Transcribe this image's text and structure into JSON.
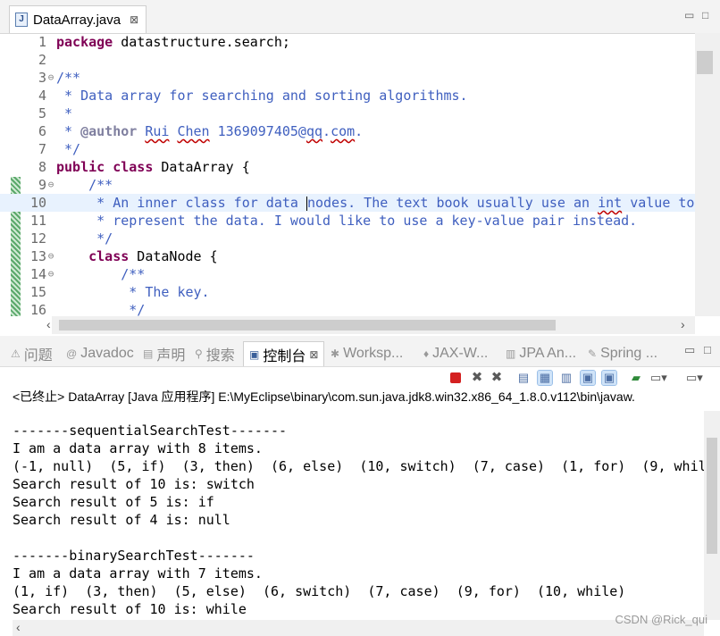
{
  "editor": {
    "tab": {
      "title": "DataArray.java",
      "close": "⊠"
    },
    "window_controls": {
      "minimize": "▭",
      "maximize": "□"
    },
    "lines": [
      {
        "n": "1",
        "fold": "",
        "html": "<span class=\"kw\">package</span> datastructure.search;"
      },
      {
        "n": "2",
        "fold": "",
        "html": ""
      },
      {
        "n": "3",
        "fold": "⊖",
        "html": "<span class=\"cm\">/**</span>"
      },
      {
        "n": "4",
        "fold": "",
        "html": "<span class=\"cm\"> * Data array for searching and sorting algorithms.</span>"
      },
      {
        "n": "5",
        "fold": "",
        "html": "<span class=\"cm\"> *</span>"
      },
      {
        "n": "6",
        "fold": "",
        "html": "<span class=\"cm\"> * <span class=\"tag\">@author</span> <span class=\"sq\">Rui</span> <span class=\"sq\">Chen</span> 1369097405@<span class=\"sq\">qq</span>.<span class=\"sq\">com</span>.</span>"
      },
      {
        "n": "7",
        "fold": "",
        "html": "<span class=\"cm\"> */</span>"
      },
      {
        "n": "8",
        "fold": "",
        "html": "<span class=\"kw\">public</span> <span class=\"kw\">class</span> DataArray {"
      },
      {
        "n": "9",
        "fold": "⊖",
        "html": "    <span class=\"cm\">/**</span>"
      },
      {
        "n": "10",
        "fold": "",
        "html": "<span class=\"cm\">     * An inner class for data <span class=\"caret\"></span>nodes. The text book usually use an <span class=\"sq\">int</span> value to</span>",
        "current": true
      },
      {
        "n": "11",
        "fold": "",
        "html": "<span class=\"cm\">     * represent the data. I would like to use a key-value pair instead.</span>"
      },
      {
        "n": "12",
        "fold": "",
        "html": "<span class=\"cm\">     */</span>"
      },
      {
        "n": "13",
        "fold": "⊖",
        "html": "    <span class=\"kw\">class</span> DataNode {"
      },
      {
        "n": "14",
        "fold": "⊖",
        "html": "        <span class=\"cm\">/**</span>"
      },
      {
        "n": "15",
        "fold": "",
        "html": "<span class=\"cm\">         * The key.</span>"
      },
      {
        "n": "16",
        "fold": "",
        "html": "<span class=\"cm\">         */</span>"
      }
    ]
  },
  "views": {
    "tabs": [
      {
        "icon": "⚠",
        "label": "问题",
        "name": "tab-problems"
      },
      {
        "icon": "@",
        "label": "Javadoc",
        "name": "tab-javadoc"
      },
      {
        "icon": "▤",
        "label": "声明",
        "name": "tab-declaration"
      },
      {
        "icon": "⚲",
        "label": "搜索",
        "name": "tab-search"
      },
      {
        "icon": "▣",
        "label": "控制台",
        "name": "tab-console",
        "active": true,
        "close": "⊠"
      },
      {
        "icon": "✱",
        "label": "Worksp...",
        "name": "tab-workspace"
      },
      {
        "icon": "♦",
        "label": "JAX-W...",
        "name": "tab-jaxws"
      },
      {
        "icon": "▥",
        "label": "JPA An...",
        "name": "tab-jpa"
      },
      {
        "icon": "✎",
        "label": "Spring ...",
        "name": "tab-spring"
      }
    ],
    "controls": {
      "minimize": "▭",
      "maximize": "□"
    }
  },
  "console": {
    "description": "<已终止> DataArray [Java 应用程序] E:\\MyEclipse\\binary\\com.sun.java.jdk8.win32.x86_64_1.8.0.v112\\bin\\javaw.",
    "output": [
      "-------sequentialSearchTest-------",
      "I am a data array with 8 items.",
      "(-1, null)  (5, if)  (3, then)  (6, else)  (10, switch)  (7, case)  (1, for)  (9, while",
      "Search result of 10 is: switch",
      "Search result of 5 is: if",
      "Search result of 4 is: null",
      "",
      "-------binarySearchTest-------",
      "I am a data array with 7 items.",
      "(1, if)  (3, then)  (5, else)  (6, switch)  (7, case)  (9, for)  (10, while)",
      "Search result of 10 is: while"
    ],
    "colors": {
      "terminate": "#d42020",
      "remove": "#5a5a5a",
      "highlight": "#cfe3f8"
    }
  },
  "watermark": "CSDN @Rick_qui"
}
